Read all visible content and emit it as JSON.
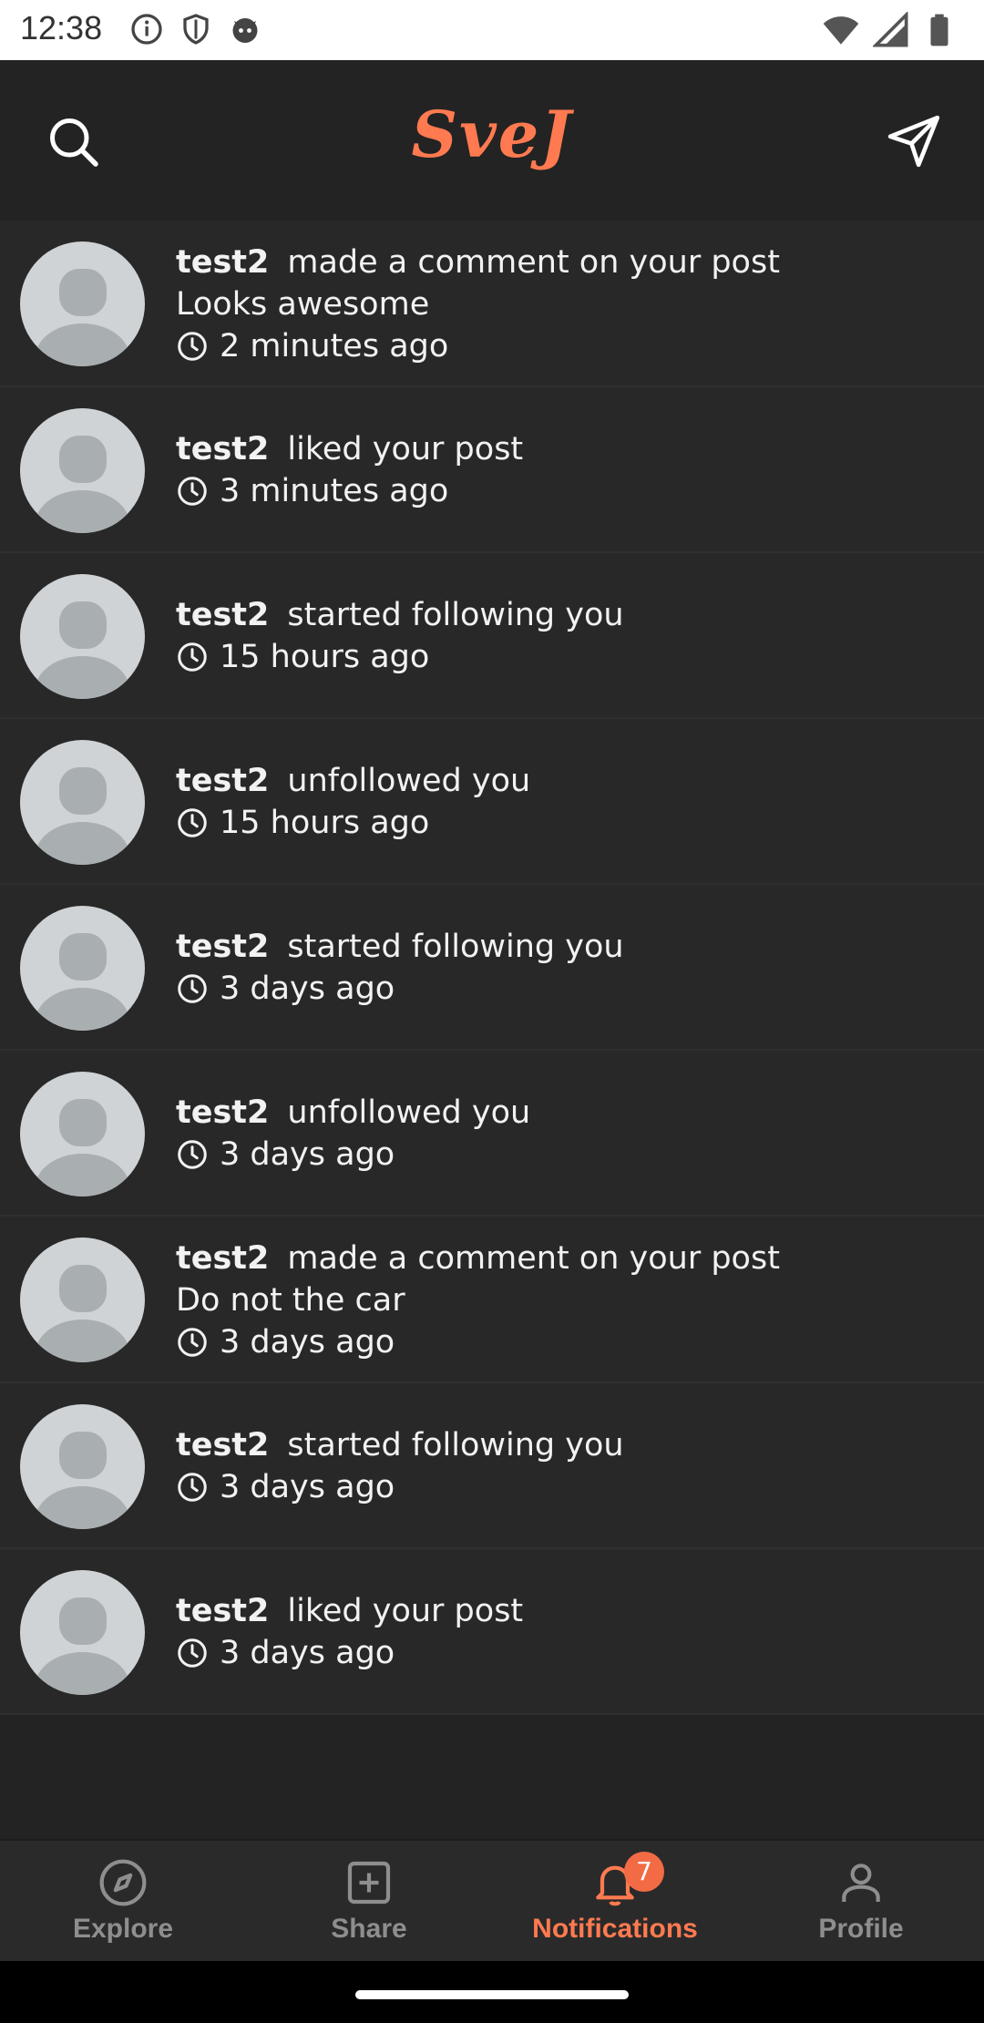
{
  "status_bar": {
    "time": "12:38",
    "left_icons": [
      "info-icon",
      "shield-icon",
      "cat-face-icon"
    ],
    "right_icons": [
      "wifi-icon",
      "signal-icon",
      "battery-icon"
    ]
  },
  "header": {
    "logo": "SveJ",
    "search_icon": "search-icon",
    "send_icon": "send-icon"
  },
  "notifications": [
    {
      "user": "test2",
      "action": "made a comment on your post",
      "comment": "Looks awesome",
      "time": "2 minutes ago"
    },
    {
      "user": "test2",
      "action": "liked your post",
      "comment": "",
      "time": "3 minutes ago"
    },
    {
      "user": "test2",
      "action": "started following you",
      "comment": "",
      "time": "15 hours ago"
    },
    {
      "user": "test2",
      "action": "unfollowed you",
      "comment": "",
      "time": "15 hours ago"
    },
    {
      "user": "test2",
      "action": "started following you",
      "comment": "",
      "time": "3 days ago"
    },
    {
      "user": "test2",
      "action": "unfollowed you",
      "comment": "",
      "time": "3 days ago"
    },
    {
      "user": "test2",
      "action": "made a comment on your post",
      "comment": "Do not the car",
      "time": "3 days ago"
    },
    {
      "user": "test2",
      "action": "started following you",
      "comment": "",
      "time": "3 days ago"
    },
    {
      "user": "test2",
      "action": "liked your post",
      "comment": "",
      "time": "3 days ago"
    }
  ],
  "bottom_nav": {
    "items": [
      {
        "label": "Explore",
        "icon": "compass-icon",
        "active": false
      },
      {
        "label": "Share",
        "icon": "plus-square-icon",
        "active": false
      },
      {
        "label": "Notifications",
        "icon": "bell-icon",
        "active": true,
        "badge": "7"
      },
      {
        "label": "Profile",
        "icon": "user-icon",
        "active": false
      }
    ]
  },
  "colors": {
    "accent": "#ff7a50",
    "background": "#232323",
    "list_item_background": "#282828",
    "nav_background": "#2a2a2a",
    "inactive_nav": "#8e8e8e",
    "avatar": "#cfd3d6",
    "avatar_figure": "#a9aeb1",
    "badge": "#f26b45"
  }
}
